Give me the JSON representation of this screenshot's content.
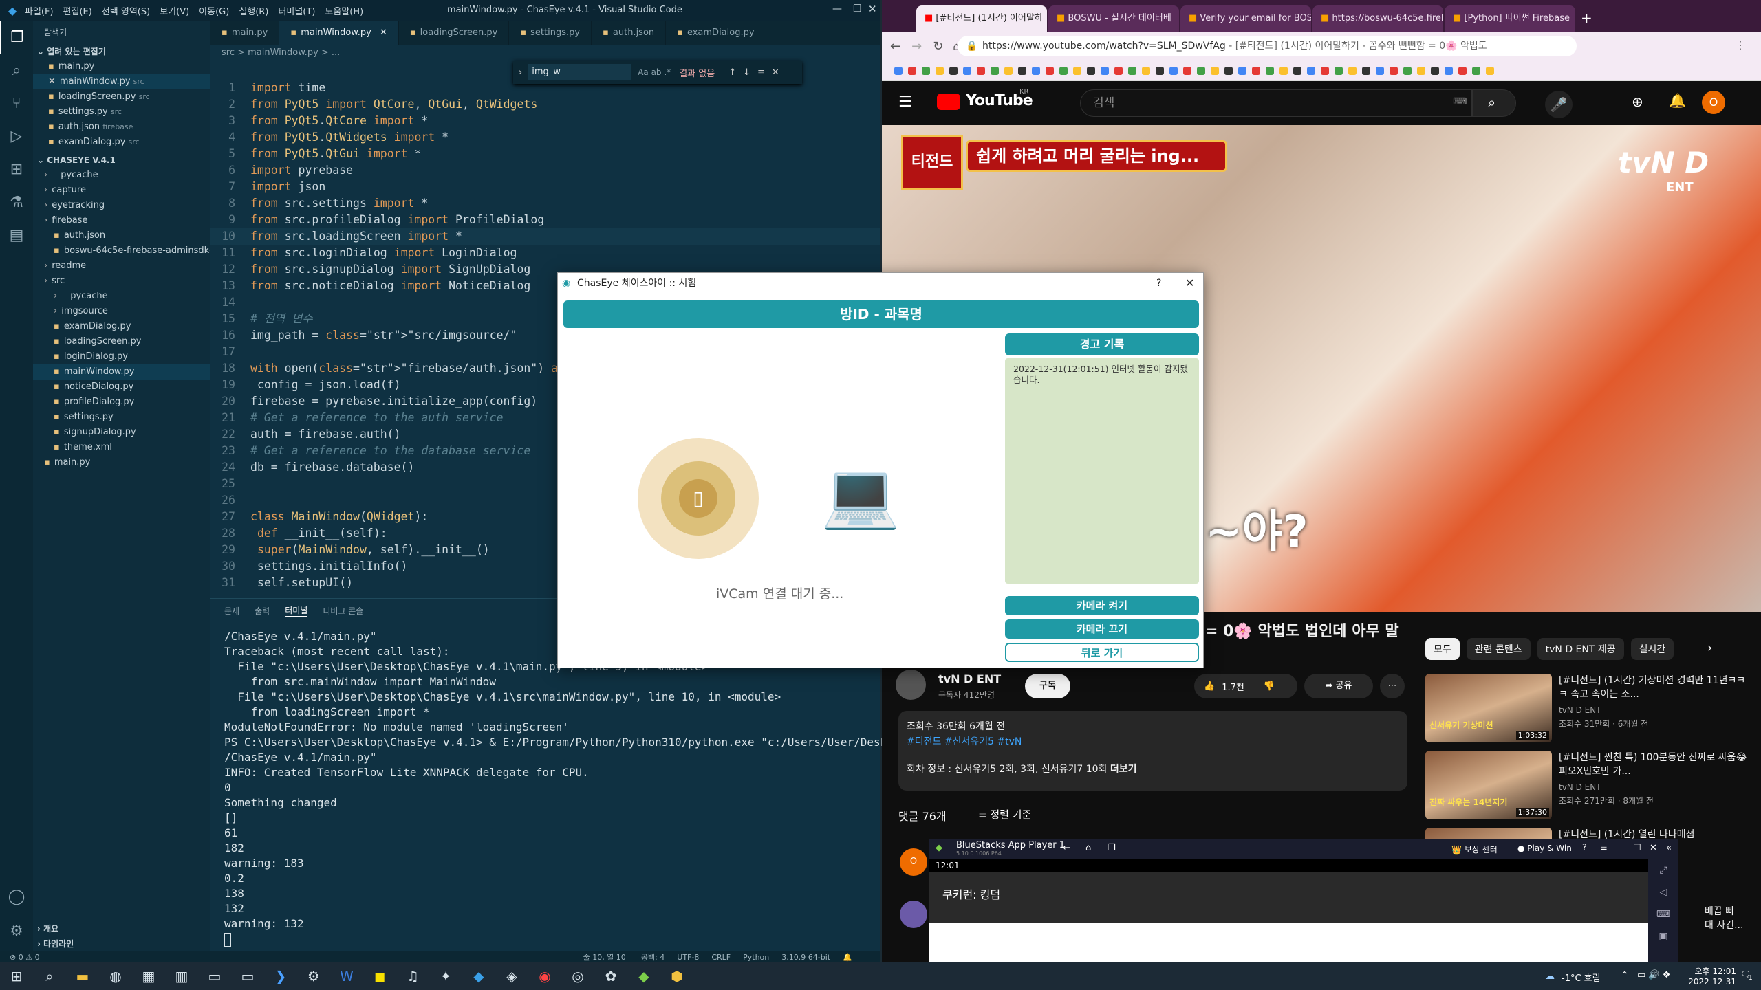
{
  "vscode": {
    "title": "mainWindow.py - ChasEye v.4.1 - Visual Studio Code",
    "menu": [
      "파일(F)",
      "편집(E)",
      "선택 영역(S)",
      "보기(V)",
      "이동(G)",
      "실행(R)",
      "터미널(T)",
      "도움말(H)"
    ],
    "tabs": [
      "main.py",
      "mainWindow.py",
      "loadingScreen.py",
      "settings.py",
      "auth.json",
      "examDialog.py"
    ],
    "breadcrumb": "src > mainWindow.py > ...",
    "find": {
      "value": "img_w",
      "result": "결과 없음"
    },
    "explorer_title": "탐색기",
    "open_editors_title": "열려 있는 편집기",
    "open_editors": [
      {
        "name": "main.py",
        "hint": ""
      },
      {
        "name": "mainWindow.py",
        "hint": "src"
      },
      {
        "name": "loadingScreen.py",
        "hint": "src"
      },
      {
        "name": "settings.py",
        "hint": "src"
      },
      {
        "name": "auth.json",
        "hint": "firebase"
      },
      {
        "name": "examDialog.py",
        "hint": "src"
      }
    ],
    "project_title": "CHASEYE V.4.1",
    "tree": [
      "__pycache__",
      "capture",
      "eyetracking",
      "firebase",
      "auth.json",
      "boswu-64c5e-firebase-adminsdk-ra...",
      "readme",
      "src",
      "__pycache__",
      "imgsource",
      "examDialog.py",
      "loadingScreen.py",
      "loginDialog.py",
      "mainWindow.py",
      "noticeDialog.py",
      "profileDialog.py",
      "settings.py",
      "signupDialog.py",
      "theme.xml",
      "main.py"
    ],
    "outline_title": "개요",
    "timeline_title": "타임라인",
    "code": [
      "import time",
      "from PyQt5 import QtCore, QtGui, QtWidgets",
      "from PyQt5.QtCore import *",
      "from PyQt5.QtWidgets import *",
      "from PyQt5.QtGui import *",
      "import pyrebase",
      "import json",
      "from src.settings import *",
      "from src.profileDialog import ProfileDialog",
      "from src.loadingScreen import *",
      "from src.loginDialog import LoginDialog",
      "from src.signupDialog import SignUpDialog",
      "from src.noticeDialog import NoticeDialog",
      "",
      "# 전역 변수",
      "img_path = \"src/imgsource/\"",
      "",
      "with open(\"firebase/auth.json\") as f:",
      "        config = json.load(f)",
      "firebase = pyrebase.initialize_app(config)",
      "# Get a reference to the auth service",
      "auth = firebase.auth()",
      "# Get a reference to the database service",
      "db = firebase.database()",
      "",
      "",
      "class MainWindow(QWidget):",
      "    def __init__(self):",
      "        super(MainWindow, self).__init__()",
      "        settings.initialInfo()",
      "        self.setupUI()"
    ],
    "panel_tabs": [
      "문제",
      "출력",
      "터미널",
      "디버그 콘솔"
    ],
    "terminal": [
      "/ChasEye v.4.1/main.py\"",
      "Traceback (most recent call last):",
      "  File \"c:\\Users\\User\\Desktop\\ChasEye v.4.1\\main.py\", line 9, in <module>",
      "    from src.mainWindow import MainWindow",
      "  File \"c:\\Users\\User\\Desktop\\ChasEye v.4.1\\src\\mainWindow.py\", line 10, in <module>",
      "    from loadingScreen import *",
      "ModuleNotFoundError: No module named 'loadingScreen'",
      "PS C:\\Users\\User\\Desktop\\ChasEye v.4.1> & E:/Program/Python/Python310/python.exe \"c:/Users/User/Desktop",
      "/ChasEye v.4.1/main.py\"",
      "INFO: Created TensorFlow Lite XNNPACK delegate for CPU.",
      "0",
      "Something changed",
      "[]",
      "61",
      "182",
      "warning: 183",
      "0.2",
      "138",
      "132",
      "warning: 132"
    ],
    "status": {
      "errors": "⊗ 0 ⚠ 0",
      "pos": "줄 10, 열 10",
      "spaces": "공백: 4",
      "enc": "UTF-8",
      "eol": "CRLF",
      "lang": "Python",
      "ver": "3.10.9 64-bit"
    }
  },
  "browser": {
    "tabs": [
      "[#티전드] (1시간) 이어말하",
      "BOSWU - 실시간 데이터베",
      "Verify your email for BOSY",
      "https://boswu-64c5e.fireba",
      "[Python] 파이썬 Firebase"
    ],
    "url": "https://www.youtube.com/watch?v=SLM_SDwVfAg",
    "url_title": "[#티전드] (1시간) 이어말하기 - 꼼수와 뻔뻔함 = 0🌸 악법도",
    "youtube": {
      "logo": "YouTube",
      "logo_region": "KR",
      "search_placeholder": "검색",
      "avatar": "O",
      "video_caption": "쉽게 하려고 머리 굴리는 ing...",
      "video_badge": "티전드",
      "video_watermark": "tvN D",
      "video_watermark_sub": "ENT",
      "video_subtitle": "~야?",
      "title_tail": "= 0🌸 악법도 법인데 아무 말",
      "channel": "tvN D ENT",
      "subs": "구독자 412만명",
      "subscribe": "구독",
      "likes": "1.7천",
      "share": "공유",
      "views": "조회수 36만회  6개월 전",
      "tags": "#티전드 #신서유기5 #tvN",
      "desc": "회차 정보 : 신서유기5 2회, 3회, 신서유기7 10회",
      "more": "더보기",
      "comments": "댓글 76개",
      "sort": "정렬 기준",
      "comment_avatar": "O",
      "chips": [
        "모두",
        "관련 콘텐츠",
        "tvN D ENT 제공",
        "실시간"
      ],
      "related": [
        {
          "title": "[#티전드] (1시간) 기상미션 경력만 11년ㅋㅋㅋ 속고 속이는 조...",
          "channel": "tvN D ENT",
          "meta": "조회수 31만회 · 6개월 전",
          "dur": "1:03:32",
          "thumb": "신서유기 기상미션"
        },
        {
          "title": "[#티전드] 찐친 특) 100분동안 진짜로 싸움😂 피오X민호만 가...",
          "channel": "tvN D ENT",
          "meta": "조회수 271만회 · 8개월 전",
          "dur": "1:37:30",
          "thumb": "진짜 싸우는 14년지기"
        },
        {
          "title": "[#티전드] (1시간) 열린 나나매점",
          "channel": "",
          "meta": "",
          "dur": "",
          "thumb": ""
        }
      ],
      "related_tail": [
        "배끕 빠",
        "대 사건..."
      ]
    }
  },
  "dialog": {
    "title": "ChasEye 체이스아이 :: 시험",
    "help": "?",
    "header": "방ID - 과목명",
    "status": "iVCam 연결 대기 중...",
    "log_title": "경고 기록",
    "log_entry": "2022-12-31(12:01:51) 인터넷 활동이 감지됐습니다.",
    "btn_on": "카메라 켜기",
    "btn_off": "카메라 끄기",
    "btn_back": "뒤로 가기"
  },
  "bluestacks": {
    "title": "BlueStacks App Player 1",
    "version": "5.10.0.1006 P64",
    "time": "12:01",
    "reward": "보상 센터",
    "playwin": "Play & Win",
    "message": "쿠키런: 킹덤"
  },
  "taskbar": {
    "weather": "-1°C  흐림",
    "time": "오후 12:01",
    "date": "2022-12-31",
    "notif": "1"
  },
  "colors": {
    "teal": "#1f9aa5",
    "log_bg": "#d7e6c8",
    "ring_outer": "#f3e2c1",
    "ring_mid": "#e4c27a",
    "ring_inner": "#c8a04f"
  }
}
